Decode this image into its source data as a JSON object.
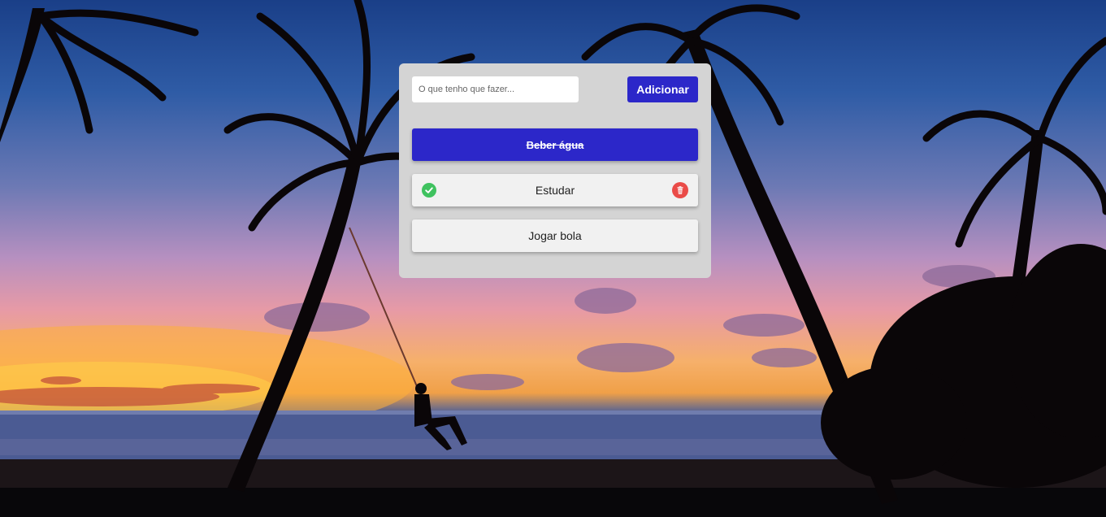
{
  "form": {
    "input_placeholder": "O que tenho que fazer...",
    "input_value": "",
    "add_label": "Adicionar"
  },
  "tasks": [
    {
      "label": "Beber água",
      "completed": true
    },
    {
      "label": "Estudar",
      "completed": false,
      "hovered": true,
      "icons": [
        "check-icon",
        "trash-icon"
      ]
    },
    {
      "label": "Jogar bola",
      "completed": false
    }
  ],
  "colors": {
    "accent": "#2c27c9",
    "panel": "#d4d4d4",
    "task_bg": "#f1f1f1",
    "check": "#3fc25f",
    "delete": "#ea4b48"
  }
}
